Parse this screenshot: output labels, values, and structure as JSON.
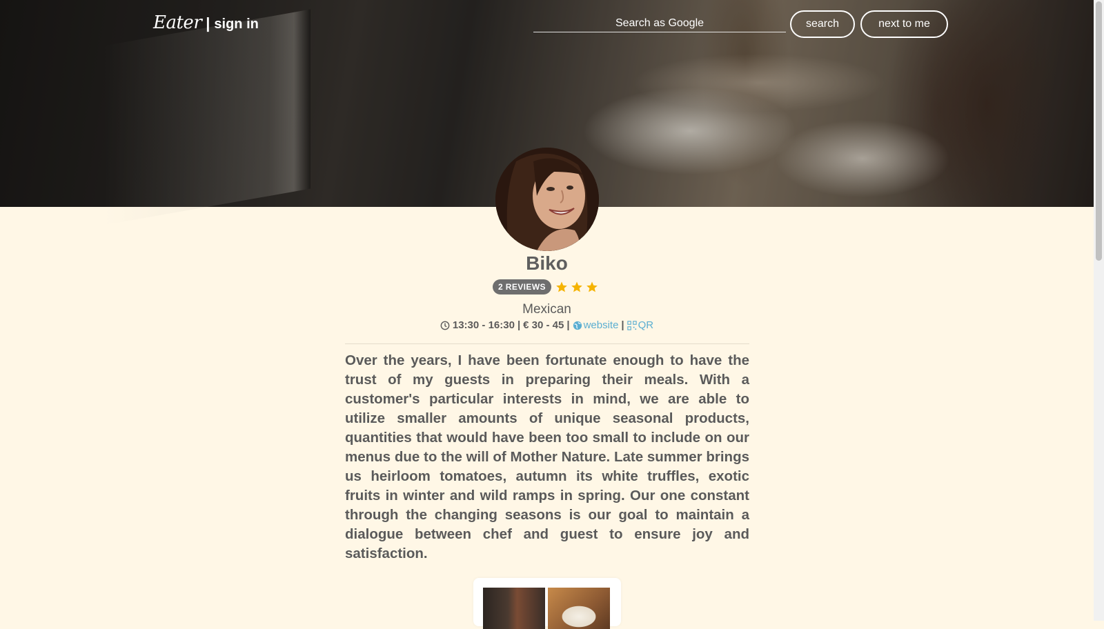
{
  "nav": {
    "brand": "Eater",
    "separator": "|",
    "signin": "sign in",
    "search_placeholder": "Search as Google",
    "search_button": "search",
    "near_button": "next to me"
  },
  "restaurant": {
    "name": "Biko",
    "reviews_badge": "2 REVIEWS",
    "stars": 3,
    "cuisine": "Mexican",
    "hours": "13:30 - 16:30",
    "price": "€ 30 - 45",
    "website_label": "website",
    "qr_label": "QR",
    "meta_separator": "|",
    "description": "Over the years, I have been fortunate enough to have the trust of my guests in preparing their meals. With a customer's particular interests in mind, we are able to utilize smaller amounts of unique seasonal products, quantities that would have been too small to include on our menus due to the will of Mother Nature. Late summer brings us heirloom tomatoes, autumn its white truffles, exotic fruits in winter and wild ramps in spring. Our one constant through the changing seasons is our goal to maintain a dialogue between chef and guest to ensure joy and satisfaction."
  },
  "colors": {
    "background": "#fff7e6",
    "star": "#f5b301",
    "link": "#5aaed1",
    "badge": "#6e6e6e"
  },
  "icons": {
    "clock": "clock-icon",
    "globe": "globe-icon",
    "qr": "qr-icon",
    "star": "star-icon"
  }
}
